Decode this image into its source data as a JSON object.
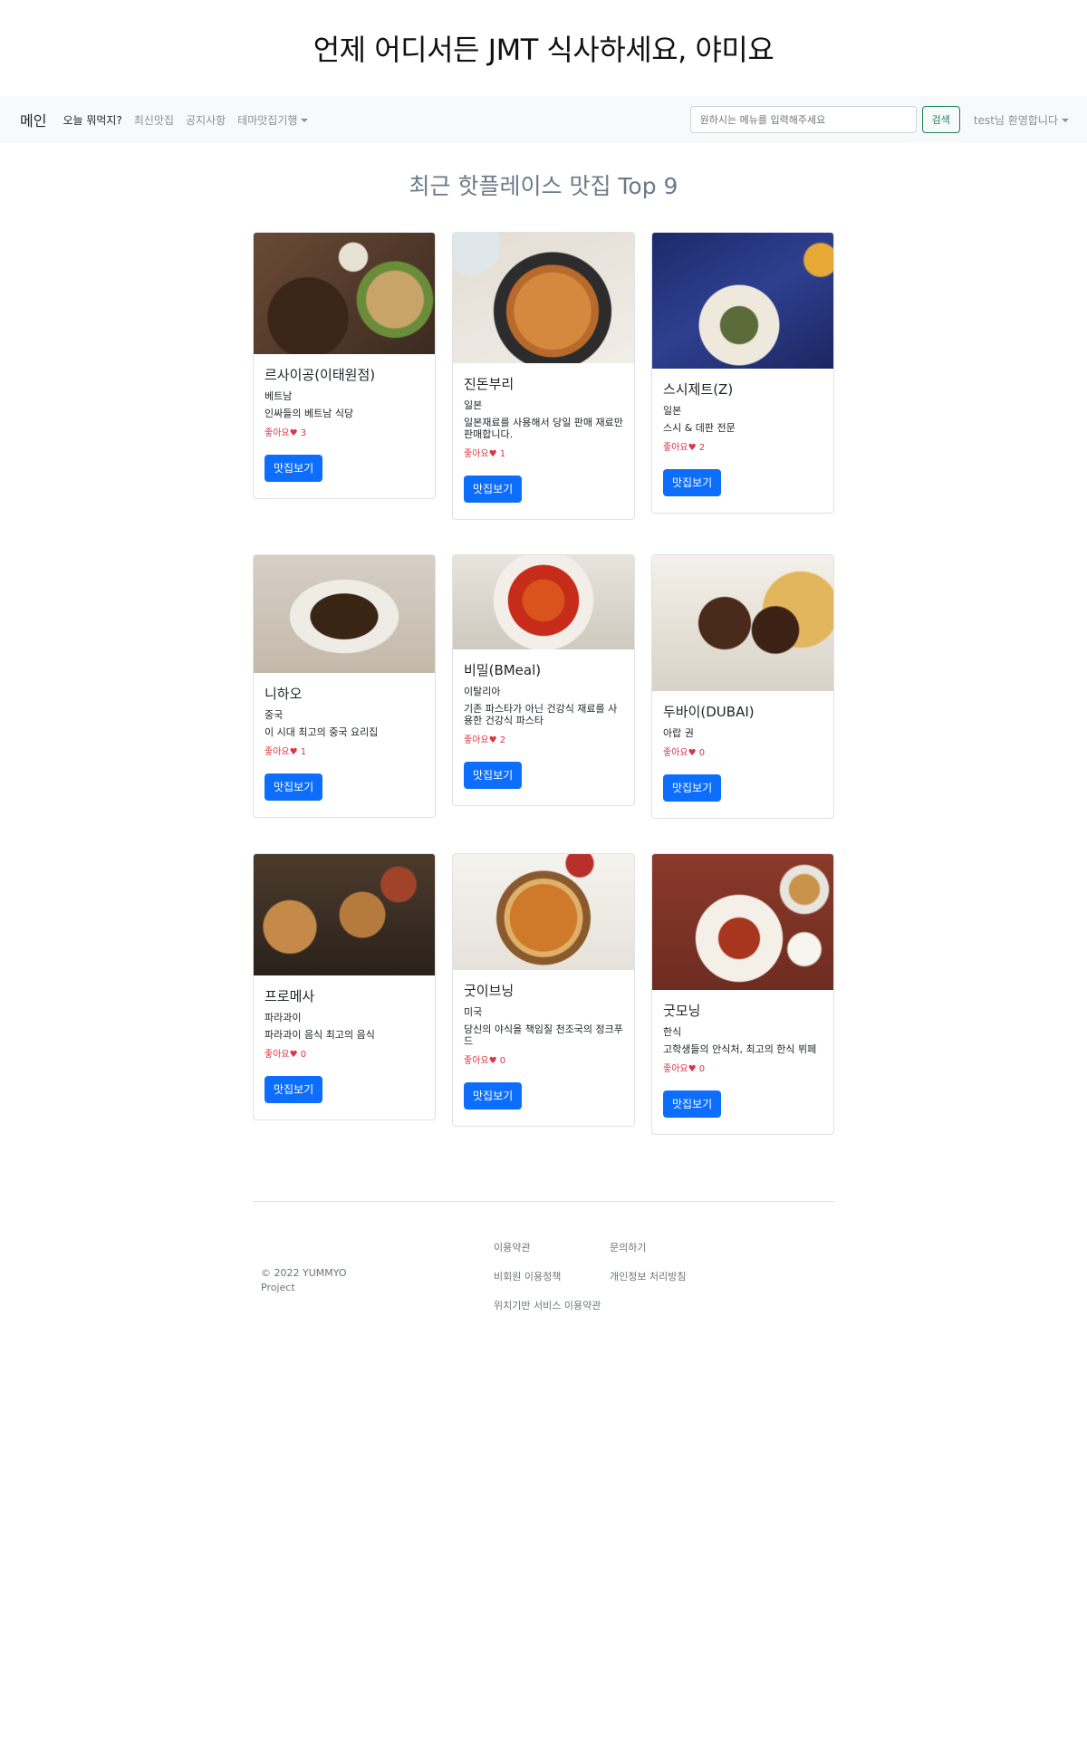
{
  "site_title": "언제 어디서든 JMT 식사하세요, 야미요",
  "nav": {
    "brand": "메인",
    "links": [
      "오늘 뭐먹지?",
      "최신맛집",
      "공지사항",
      "테마맛집기행"
    ],
    "search_placeholder": "원하시는 메뉴를 입력해주세요",
    "search_button": "검색",
    "user_greeting": "test님 환영합니다"
  },
  "section_title": "최근 핫플레이스 맛집 Top 9",
  "like_label": "좋아요",
  "button_label": "맛집보기",
  "restaurants": [
    {
      "name": "르사이공(이태원점)",
      "category": "베트남",
      "description": "인싸들의 베트남 식당",
      "likes": "3"
    },
    {
      "name": "진돈부리",
      "category": "일본",
      "description": "일본재료를 사용해서 당일 판매 재료만 판매합니다.",
      "likes": "1"
    },
    {
      "name": "스시제트(Z)",
      "category": "일본",
      "description": "스시 & 데판 전문",
      "likes": "2"
    },
    {
      "name": "니하오",
      "category": "중국",
      "description": "이 시대 최고의 중국 요리집",
      "likes": "1"
    },
    {
      "name": "비밀(BMeal)",
      "category": "이탈리아",
      "description": "기존 파스타가 아닌 건강식 재료를 사용한 건강식 파스타",
      "likes": "2"
    },
    {
      "name": "두바이(DUBAI)",
      "category": "아랍 권",
      "description": "",
      "likes": "0"
    },
    {
      "name": "프로메사",
      "category": "파라과이",
      "description": "파라과이 음식 최고의 음식",
      "likes": "0"
    },
    {
      "name": "굿이브닝",
      "category": "미국",
      "description": "당신의 야식을 책임질 천조국의 정크푸드",
      "likes": "0"
    },
    {
      "name": "굿모닝",
      "category": "한식",
      "description": "고학생들의 안식처, 최고의 한식 뷔페",
      "likes": "0"
    }
  ],
  "footer": {
    "copyright": "© 2022 YUMMYO Project",
    "links": [
      "이용약관",
      "문의하기",
      "비회원 이용정책",
      "개인정보 처리방침",
      "위치기반 서비스 이용약관"
    ]
  },
  "colors": {
    "primary_button": "#0d6efd",
    "like_red": "#dc3545",
    "search_green": "#198754",
    "navbar_bg": "#f8f9fa",
    "section_title": "#6c7a89"
  }
}
